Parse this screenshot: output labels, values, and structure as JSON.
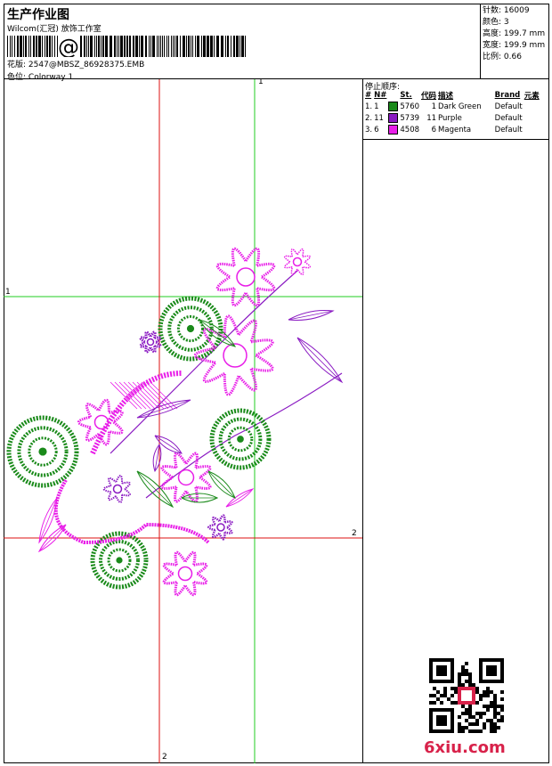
{
  "header": {
    "title": "生产作业图",
    "company": "Wilcom(汇冠) 放饰工作室",
    "design_label": "花版:",
    "design_value": "2547@MBSZ_86928375.EMB",
    "colorway_label": "色位:",
    "colorway_value": "Colorway 1",
    "barcode_glyph": "@"
  },
  "specs": [
    {
      "label": "针数:",
      "value": "16009"
    },
    {
      "label": "颜色:",
      "value": "3"
    },
    {
      "label": "高度:",
      "value": "199.7 mm"
    },
    {
      "label": "宽度:",
      "value": "199.9 mm"
    },
    {
      "label": "比例:",
      "value": "0.66"
    }
  ],
  "stop_sequence": {
    "title": "停止顺序:",
    "columns": [
      "#",
      "N#",
      "St.",
      "代码",
      "描述",
      "Brand",
      "元素"
    ],
    "rows": [
      {
        "num": "1.",
        "needle": "1",
        "color": "#1a8a1a",
        "stitches": "5760",
        "code": "1",
        "desc": "Dark Green",
        "brand": "Default"
      },
      {
        "num": "2.",
        "needle": "11",
        "color": "#8a1ac2",
        "stitches": "5739",
        "code": "11",
        "desc": "Purple",
        "brand": "Default"
      },
      {
        "num": "3.",
        "needle": "6",
        "color": "#e81ee8",
        "stitches": "4508",
        "code": "6",
        "desc": "Magenta",
        "brand": "Default"
      }
    ]
  },
  "guides": {
    "green_label_top": "1",
    "green_label_left": "1",
    "red_label_bottom": "2",
    "red_label_right": "2",
    "green_color": "#22cc22",
    "red_color": "#dd1111"
  },
  "embroidery_colors": {
    "green": "#1a8a1a",
    "purple": "#8a1ac2",
    "magenta": "#e81ee8"
  },
  "watermark": {
    "logo": "6xiu.com"
  }
}
